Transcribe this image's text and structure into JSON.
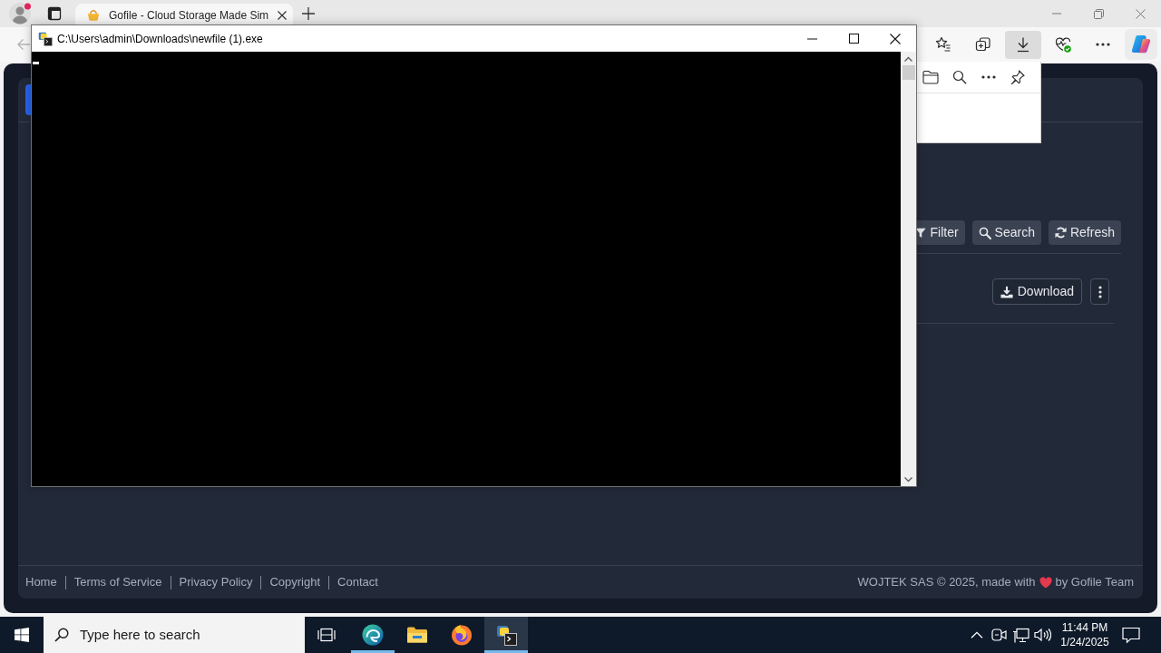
{
  "browser": {
    "tabs": [
      {
        "title": "Gofile - Cloud Storage Made Sim",
        "selected": true
      }
    ],
    "toolbar": [
      {
        "kind": "favorites",
        "active": false
      },
      {
        "kind": "collections",
        "active": false
      },
      {
        "kind": "downloads",
        "active": true
      },
      {
        "kind": "essentials",
        "active": false
      },
      {
        "kind": "more",
        "active": false
      },
      {
        "kind": "copilot",
        "active": false
      }
    ],
    "downloads_flyout": {
      "open": true
    },
    "page": {
      "toolbar_buttons": [
        {
          "kind": "filter",
          "label": "Filter"
        },
        {
          "kind": "search",
          "label": "Search"
        },
        {
          "kind": "refresh",
          "label": "Refresh"
        }
      ],
      "file_actions": [
        {
          "kind": "download",
          "label": "Download"
        },
        {
          "kind": "menu"
        }
      ],
      "footer_links": [
        "Home",
        "Terms of Service",
        "Privacy Policy",
        "Copyright",
        "Contact"
      ],
      "credit": {
        "before": "WOJTEK SAS © 2025, made with",
        "after": "by Gofile Team"
      }
    }
  },
  "console": {
    "title": "C:\\Users\\admin\\Downloads\\newfile (1).exe"
  },
  "taskbar": {
    "search": {
      "placeholder": "Type here to search"
    },
    "apps": [
      {
        "kind": "edge",
        "running": true,
        "active": false
      },
      {
        "kind": "explorer",
        "running": false,
        "active": false
      },
      {
        "kind": "firefox",
        "running": false,
        "active": false
      },
      {
        "kind": "console",
        "running": true,
        "active": true
      }
    ],
    "clock": {
      "time": "11:44 PM",
      "date": "1/24/2025"
    }
  }
}
